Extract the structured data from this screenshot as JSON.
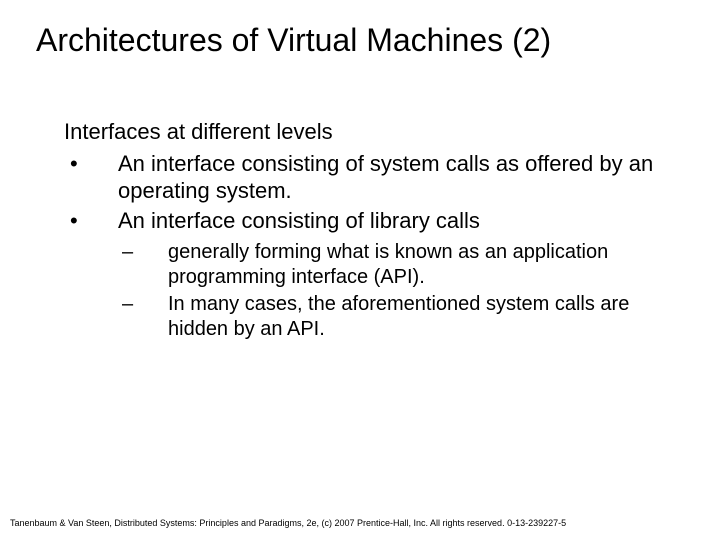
{
  "title": "Architectures of Virtual Machines (2)",
  "intro": "Interfaces at different levels",
  "bullets": [
    {
      "text": "An interface consisting of system calls as offered by an operating system."
    },
    {
      "text": "An interface consisting of library calls"
    }
  ],
  "subbullets": [
    {
      "text": "generally forming what is known as an application programming interface (API)."
    },
    {
      "text": "In many cases, the aforementioned system calls are hidden by an API."
    }
  ],
  "footer": "Tanenbaum & Van Steen, Distributed Systems: Principles and Paradigms, 2e, (c) 2007 Prentice-Hall, Inc. All rights reserved. 0-13-239227-5"
}
